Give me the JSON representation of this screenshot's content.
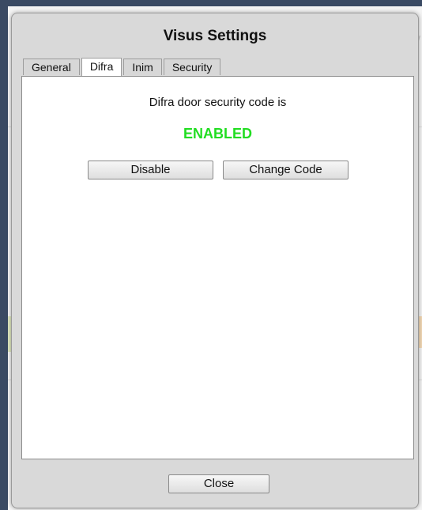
{
  "background": {
    "corner_text": "0 W"
  },
  "dialog": {
    "title": "Visus Settings",
    "tabs": [
      {
        "label": "General",
        "active": false
      },
      {
        "label": "Difra",
        "active": true
      },
      {
        "label": "Inim",
        "active": false
      },
      {
        "label": "Security",
        "active": false
      }
    ],
    "difra": {
      "status_text": "Difra door security code is",
      "status_value": "ENABLED",
      "status_color": "#22dd22",
      "disable_label": "Disable",
      "change_code_label": "Change Code"
    },
    "close_label": "Close"
  }
}
